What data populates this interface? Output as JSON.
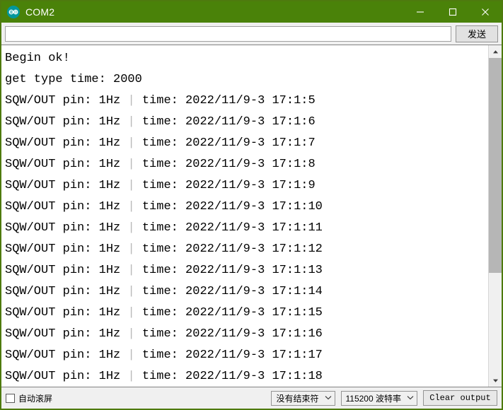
{
  "window": {
    "title": "COM2",
    "logo_icon": "arduino-infinity-icon",
    "accent_green": "#4a8209",
    "border_green": "#4e7a0e",
    "controls": {
      "minimize": "—",
      "maximize": "□",
      "close": "✕"
    }
  },
  "sendbar": {
    "input_value": "",
    "input_placeholder": "",
    "send_label": "发送"
  },
  "console": {
    "lines": [
      {
        "text": "Begin ok!",
        "type": "plain"
      },
      {
        "text": "get type time: 2000",
        "type": "plain"
      },
      {
        "prefix": "SQW/OUT pin: 1Hz ",
        "sep": "|",
        "suffix": " time: 2022/11/9-3 17:1:5",
        "type": "log"
      },
      {
        "prefix": "SQW/OUT pin: 1Hz ",
        "sep": "|",
        "suffix": " time: 2022/11/9-3 17:1:6",
        "type": "log"
      },
      {
        "prefix": "SQW/OUT pin: 1Hz ",
        "sep": "|",
        "suffix": " time: 2022/11/9-3 17:1:7",
        "type": "log"
      },
      {
        "prefix": "SQW/OUT pin: 1Hz ",
        "sep": "|",
        "suffix": " time: 2022/11/9-3 17:1:8",
        "type": "log"
      },
      {
        "prefix": "SQW/OUT pin: 1Hz ",
        "sep": "|",
        "suffix": " time: 2022/11/9-3 17:1:9",
        "type": "log"
      },
      {
        "prefix": "SQW/OUT pin: 1Hz ",
        "sep": "|",
        "suffix": " time: 2022/11/9-3 17:1:10",
        "type": "log"
      },
      {
        "prefix": "SQW/OUT pin: 1Hz ",
        "sep": "|",
        "suffix": " time: 2022/11/9-3 17:1:11",
        "type": "log"
      },
      {
        "prefix": "SQW/OUT pin: 1Hz ",
        "sep": "|",
        "suffix": " time: 2022/11/9-3 17:1:12",
        "type": "log"
      },
      {
        "prefix": "SQW/OUT pin: 1Hz ",
        "sep": "|",
        "suffix": " time: 2022/11/9-3 17:1:13",
        "type": "log"
      },
      {
        "prefix": "SQW/OUT pin: 1Hz ",
        "sep": "|",
        "suffix": " time: 2022/11/9-3 17:1:14",
        "type": "log"
      },
      {
        "prefix": "SQW/OUT pin: 1Hz ",
        "sep": "|",
        "suffix": " time: 2022/11/9-3 17:1:15",
        "type": "log"
      },
      {
        "prefix": "SQW/OUT pin: 1Hz ",
        "sep": "|",
        "suffix": " time: 2022/11/9-3 17:1:16",
        "type": "log"
      },
      {
        "prefix": "SQW/OUT pin: 1Hz ",
        "sep": "|",
        "suffix": " time: 2022/11/9-3 17:1:17",
        "type": "log"
      },
      {
        "prefix": "SQW/OUT pin: 1Hz ",
        "sep": "|",
        "suffix": " time: 2022/11/9-3 17:1:18",
        "type": "log"
      }
    ]
  },
  "scrollbar": {
    "up_arrow": "▲",
    "down_arrow": "▼",
    "thumb_top_percent": 0,
    "thumb_height_percent": 68
  },
  "statusbar": {
    "autoscroll_label": "自动滚屏",
    "autoscroll_checked": false,
    "line_ending": "没有结束符",
    "baud_rate": "115200 波特率",
    "clear_label": "Clear output",
    "caret_glyph": "∨"
  }
}
